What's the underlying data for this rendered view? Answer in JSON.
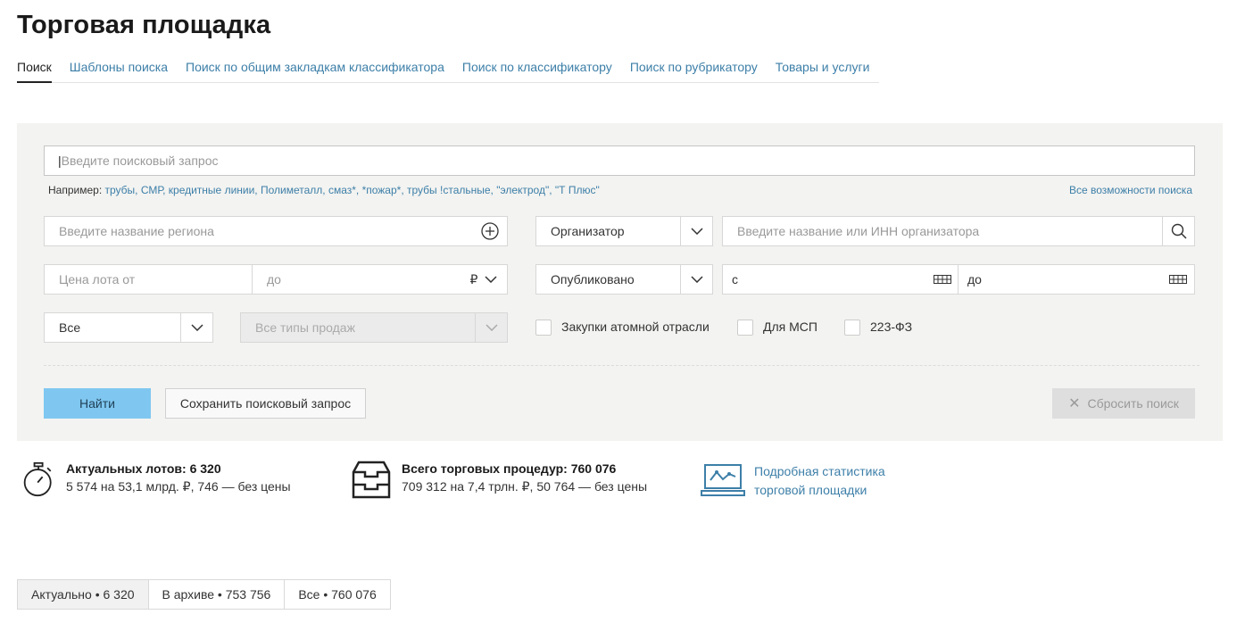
{
  "page": {
    "title": "Торговая площадка"
  },
  "tabs": [
    {
      "label": "Поиск"
    },
    {
      "label": "Шаблоны поиска"
    },
    {
      "label": "Поиск по общим закладкам классификатора"
    },
    {
      "label": "Поиск по классификатору"
    },
    {
      "label": "Поиск по рубрикатору"
    },
    {
      "label": "Товары и услуги"
    }
  ],
  "search": {
    "placeholder": "Введите поисковый запрос",
    "examples_prefix": "Например:",
    "examples_links": "трубы, СМР, кредитные линии, Полиметалл, смаз*, *пожар*, трубы !стальные, \"электрод\", \"Т Плюс\"",
    "all_features": "Все возможности поиска"
  },
  "filters": {
    "region_placeholder": "Введите название региона",
    "organizer_select": "Организатор",
    "organizer_placeholder": "Введите название или ИНН организатора",
    "price_from_placeholder": "Цена лота от",
    "price_to_placeholder": "до",
    "currency": "₽",
    "published_select": "Опубликовано",
    "date_from": "с",
    "date_to": "до",
    "all_select": "Все",
    "sale_types_placeholder": "Все типы продаж",
    "checkboxes": [
      {
        "label": "Закупки атомной отрасли",
        "checked": false
      },
      {
        "label": "Для МСП",
        "checked": false
      },
      {
        "label": "223-ФЗ",
        "checked": false
      }
    ]
  },
  "buttons": {
    "find": "Найти",
    "save": "Сохранить поисковый запрос",
    "reset": "Сбросить поиск"
  },
  "stats": {
    "lots_title": "Актуальных лотов: 6 320",
    "lots_sub": "5 574 на 53,1 млрд. ₽, 746 — без цены",
    "procedures_title": "Всего торговых процедур: 760 076",
    "procedures_sub": "709 312 на 7,4 трлн. ₽, 50 764 — без цены",
    "detail_link_line1": "Подробная статистика",
    "detail_link_line2": "торговой площадки"
  },
  "bottom_tabs": [
    {
      "label": "Актуально • 6 320"
    },
    {
      "label": "В архиве • 753 756"
    },
    {
      "label": "Все • 760 076"
    }
  ],
  "colors": {
    "link": "#3d7fa8",
    "find_button": "#7fc7f0",
    "panel": "#f3f3f1"
  },
  "icons": [
    "plus-circle-icon",
    "chevron-down-icon",
    "search-icon",
    "calendar-icon",
    "close-icon",
    "stopwatch-icon",
    "inbox-tray-icon",
    "laptop-chart-icon"
  ]
}
